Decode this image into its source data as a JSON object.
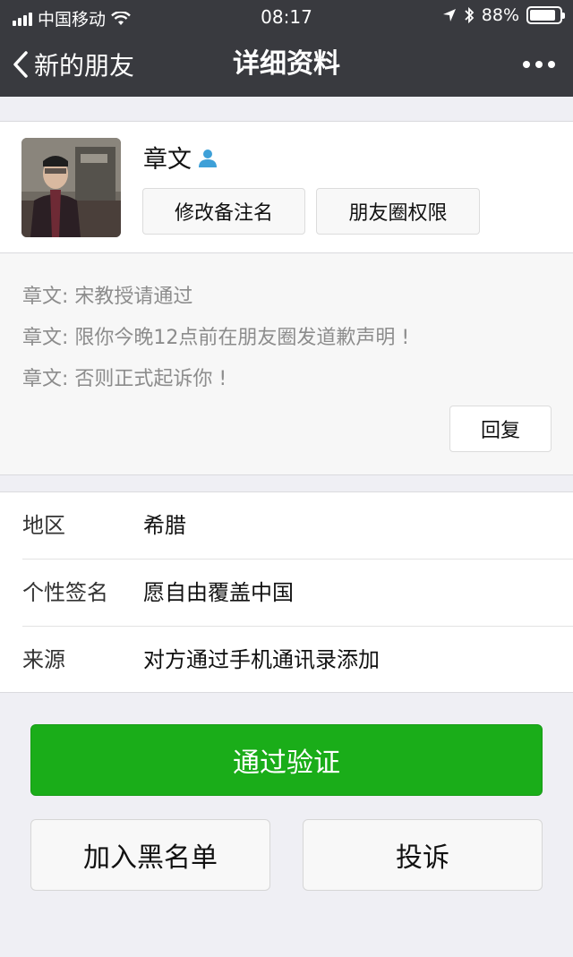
{
  "status_bar": {
    "carrier": "中国移动",
    "time": "08:17",
    "battery": "88%",
    "battery_level": 0.88
  },
  "nav": {
    "back_label": "新的朋友",
    "title": "详细资料",
    "more_icon": "more-icon"
  },
  "profile": {
    "name": "章文",
    "contact_icon": "contact-person-icon",
    "edit_remark_label": "修改备注名",
    "moments_permission_label": "朋友圈权限"
  },
  "messages": [
    "章文: 宋教授请通过",
    "章文: 限你今晚12点前在朋友圈发道歉声明 !",
    "章文: 否则正式起诉你 !"
  ],
  "reply_label": "回复",
  "info_rows": [
    {
      "label": "地区",
      "value": "希腊"
    },
    {
      "label": "个性签名",
      "value": "愿自由覆盖中国"
    },
    {
      "label": "来源",
      "value": "对方通过手机通讯录添加"
    }
  ],
  "actions": {
    "approve_label": "通过验证",
    "blacklist_label": "加入黑名单",
    "report_label": "投诉"
  },
  "colors": {
    "nav_bg": "#393a3f",
    "primary_green": "#1aad19",
    "page_bg": "#efeff4"
  }
}
